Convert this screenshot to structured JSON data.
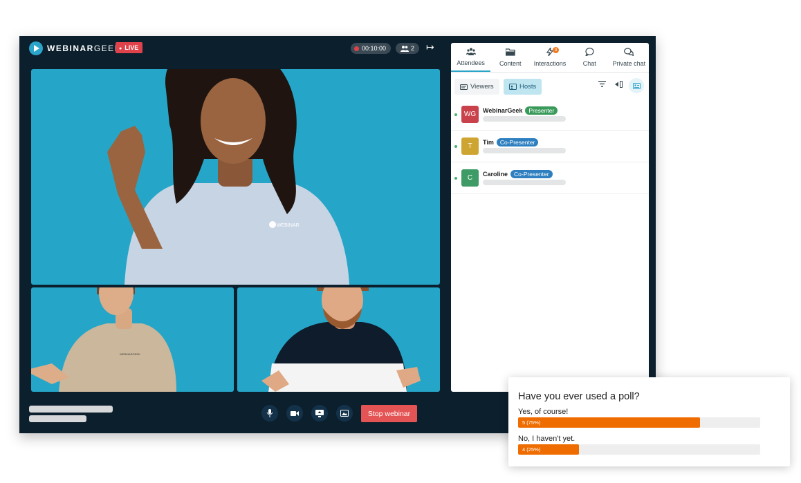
{
  "header": {
    "logo_bold": "WEBINAR",
    "logo_light": "GEEK",
    "live_label": "LIVE",
    "timer": "00:10:00",
    "participants_count": "2"
  },
  "controls": {
    "stop_label": "Stop webinar",
    "icons": [
      "microphone-icon",
      "camera-icon",
      "screenshare-icon",
      "image-icon"
    ]
  },
  "sidebar": {
    "tabs": [
      {
        "label": "Attendees",
        "icon": "attendees-icon"
      },
      {
        "label": "Content",
        "icon": "folder-icon"
      },
      {
        "label": "Interactions",
        "icon": "lightning-icon",
        "badge": "3"
      },
      {
        "label": "Chat",
        "icon": "chat-icon"
      },
      {
        "label": "Private chat",
        "icon": "private-chat-icon"
      }
    ],
    "subtabs": {
      "viewers": "Viewers",
      "hosts": "Hosts"
    },
    "hosts": [
      {
        "initials": "WG",
        "name": "WebinarGeek",
        "role": "Presenter",
        "avatar_color": "#c9414b",
        "role_color": "#3a9a5b"
      },
      {
        "initials": "T",
        "name": "Tim",
        "role": "Co-Presenter",
        "avatar_color": "#cfa531",
        "role_color": "#2d7fbf"
      },
      {
        "initials": "C",
        "name": "Caroline",
        "role": "Co-Presenter",
        "avatar_color": "#3e9b66",
        "role_color": "#2d7fbf"
      }
    ]
  },
  "poll": {
    "question": "Have you ever used a poll?",
    "options": [
      {
        "label": "Yes, of course!",
        "result": "5 (75%)",
        "fraction": 0.75
      },
      {
        "label": "No, I haven't yet.",
        "result": "4 (25%)",
        "fraction": 0.25
      }
    ]
  },
  "colors": {
    "accent": "#2ba4c9",
    "live": "#e0424b",
    "stop": "#e55455",
    "poll_bar": "#ef6c00"
  }
}
